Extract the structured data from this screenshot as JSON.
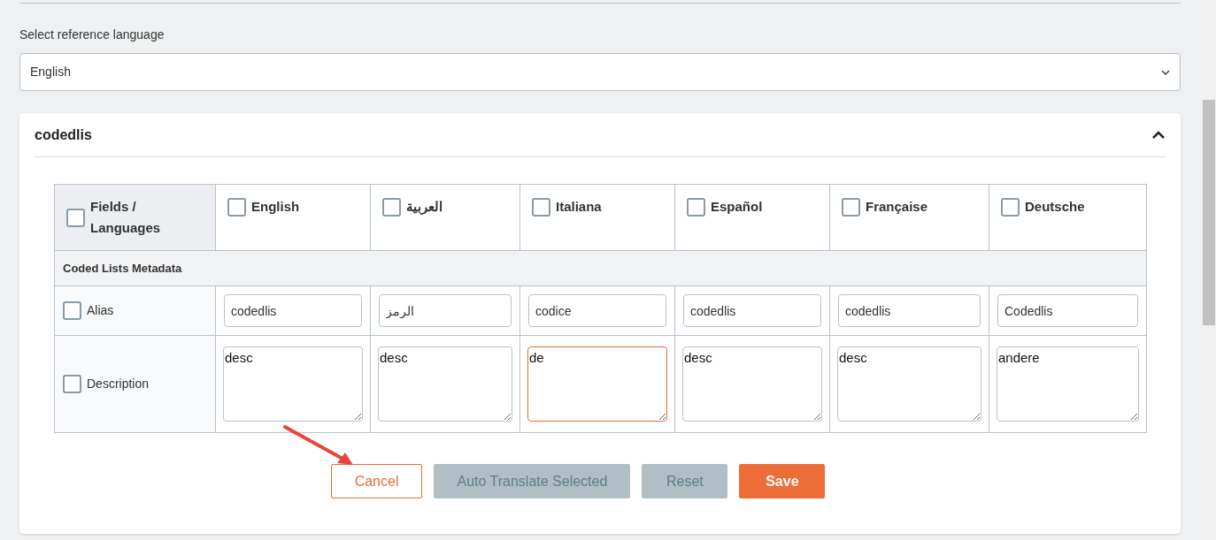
{
  "reference_language": {
    "label": "Select reference language",
    "value": "English"
  },
  "panel": {
    "title": "codedlis",
    "expanded": true,
    "table": {
      "corner": {
        "label": "Fields / Languages",
        "checked": false
      },
      "languages": [
        {
          "label": "English",
          "checked": false
        },
        {
          "label": "العربية",
          "checked": false
        },
        {
          "label": "Italiana",
          "checked": false
        },
        {
          "label": "Español",
          "checked": false
        },
        {
          "label": "Française",
          "checked": false
        },
        {
          "label": "Deutsche",
          "checked": false
        }
      ],
      "section": "Coded Lists Metadata",
      "rows": [
        {
          "label": "Alias",
          "kind": "input",
          "checked": false,
          "values": [
            {
              "text": "codedlis",
              "focused": false
            },
            {
              "text": "الرمز",
              "focused": false
            },
            {
              "text": "codice",
              "focused": false
            },
            {
              "text": "codedlis",
              "focused": false
            },
            {
              "text": "codedlis",
              "focused": false
            },
            {
              "text": "Codedlis",
              "focused": false
            }
          ]
        },
        {
          "label": "Description",
          "kind": "textarea",
          "checked": false,
          "values": [
            {
              "text": "desc",
              "focused": false
            },
            {
              "text": "desc",
              "focused": false
            },
            {
              "text": "de",
              "focused": true
            },
            {
              "text": "desc",
              "focused": false
            },
            {
              "text": "desc",
              "focused": false
            },
            {
              "text": "andere",
              "focused": false
            }
          ]
        }
      ]
    },
    "buttons": [
      {
        "label": "Cancel",
        "kind": "outline",
        "disabled": false
      },
      {
        "label": "Auto Translate Selected",
        "disabled": true
      },
      {
        "label": "Reset",
        "disabled": true
      },
      {
        "label": "Save",
        "kind": "primary",
        "disabled": false
      }
    ]
  }
}
